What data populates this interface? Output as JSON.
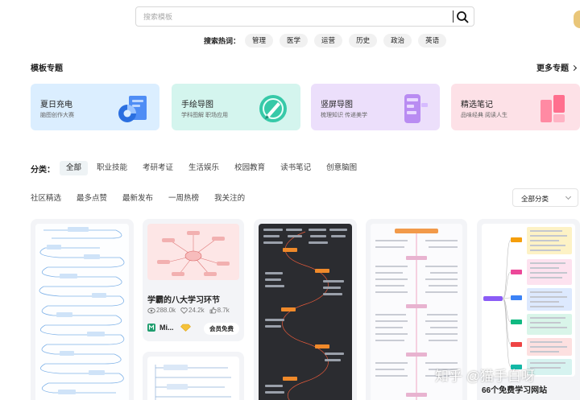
{
  "search": {
    "placeholder": "搜索模板"
  },
  "hot": {
    "label": "搜索热词：",
    "tags": [
      "管理",
      "医学",
      "运营",
      "历史",
      "政治",
      "英语"
    ]
  },
  "topics_section": {
    "title": "模板专题",
    "more": "更多专题"
  },
  "topics": [
    {
      "title": "夏日充电",
      "sub": "脑图创作大赛",
      "bg": "#dbeeff"
    },
    {
      "title": "手绘导图",
      "sub": "学科图解 职场应用",
      "bg": "#d4f5ee"
    },
    {
      "title": "竖屏导图",
      "sub": "梳理知识 传递美学",
      "bg": "#ecdffb"
    },
    {
      "title": "精选笔记",
      "sub": "品味经典 阅读人生",
      "bg": "#fde1e7"
    }
  ],
  "filter": {
    "label": "分类：",
    "items": [
      "全部",
      "职业技能",
      "考研考证",
      "生活娱乐",
      "校园教育",
      "读书笔记",
      "创意脑图"
    ],
    "active": "全部"
  },
  "sort": {
    "items": [
      "社区精选",
      "最多点赞",
      "最新发布",
      "一周热榜",
      "我关注的"
    ]
  },
  "category_select": {
    "value": "全部分类"
  },
  "cards": [
    {
      "title": "学霸的八大学习环节",
      "views": "288.0k",
      "likes": "24.2k",
      "thumbs": "8.7k",
      "author": "Mi...",
      "badge": "会员免费"
    },
    {
      "title": "66个免费学习网站"
    }
  ],
  "watermark": "知乎 @猫手白呀",
  "colors": {
    "accent": "#1f9d6e",
    "card_bg": "#f3f4f7",
    "tag_bg": "#f1f1f1"
  }
}
